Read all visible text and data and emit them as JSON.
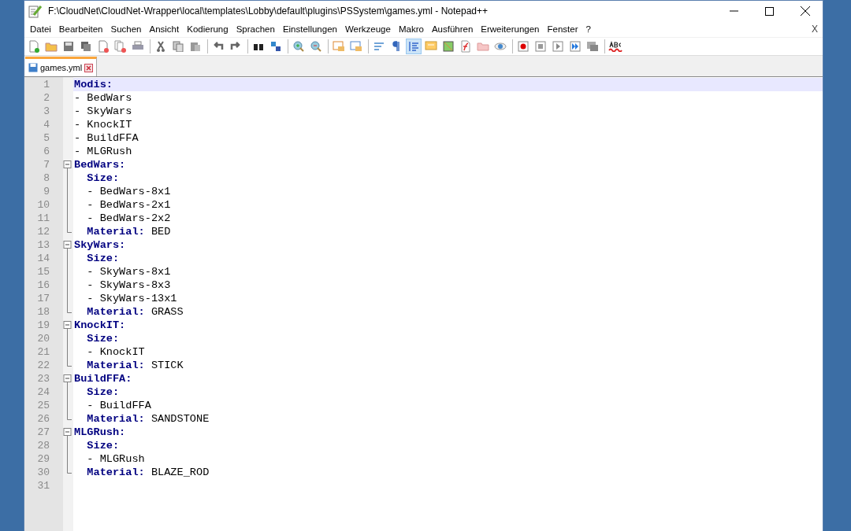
{
  "window": {
    "title": "F:\\CloudNet\\CloudNet-Wrapper\\local\\templates\\Lobby\\default\\plugins\\PSSystem\\games.yml - Notepad++"
  },
  "menu": [
    "Datei",
    "Bearbeiten",
    "Suchen",
    "Ansicht",
    "Kodierung",
    "Sprachen",
    "Einstellungen",
    "Werkzeuge",
    "Makro",
    "Ausführen",
    "Erweiterungen",
    "Fenster",
    "?"
  ],
  "menu_close": "X",
  "toolbar": [
    {
      "pressed": false
    },
    {
      "pressed": false
    },
    {
      "pressed": false
    },
    {
      "pressed": false
    },
    {
      "pressed": false
    },
    {
      "pressed": false
    },
    {
      "pressed": false
    },
    {
      "pressed": false
    },
    {
      "pressed": false
    },
    {
      "pressed": false
    },
    {
      "pressed": false
    },
    {
      "pressed": false
    },
    {
      "pressed": false
    },
    {
      "pressed": false
    },
    {
      "pressed": false
    },
    {
      "pressed": false
    },
    {
      "pressed": false
    },
    {
      "pressed": false
    },
    {
      "pressed": false
    },
    {
      "pressed": false
    },
    {
      "pressed": true
    },
    {
      "pressed": false
    },
    {
      "pressed": false
    },
    {
      "pressed": false
    },
    {
      "pressed": false
    },
    {
      "pressed": false
    },
    {
      "pressed": false
    },
    {
      "pressed": false
    },
    {
      "pressed": false
    },
    {
      "pressed": false
    },
    {
      "pressed": false
    },
    {
      "pressed": false
    }
  ],
  "tabs": [
    {
      "label": "games.yml",
      "selected": true
    }
  ],
  "lines": [
    {
      "number": "1",
      "kind": "plain",
      "key": "Modis:",
      "current": true
    },
    {
      "number": "2",
      "kind": "plain",
      "value": "- BedWars",
      "current": false
    },
    {
      "number": "3",
      "kind": "plain",
      "value": "- SkyWars",
      "current": false
    },
    {
      "number": "4",
      "kind": "plain",
      "value": "- KnockIT",
      "current": false
    },
    {
      "number": "5",
      "kind": "plain",
      "value": "- BuildFFA",
      "current": false
    },
    {
      "number": "6",
      "kind": "plain",
      "value": "- MLGRush",
      "current": false
    },
    {
      "number": "7",
      "kind": "fold-start",
      "key": "BedWars:",
      "current": false
    },
    {
      "number": "8",
      "kind": "fold-line",
      "key": "  Size:",
      "current": false
    },
    {
      "number": "9",
      "kind": "fold-line",
      "value": "  - BedWars-8x1",
      "current": false
    },
    {
      "number": "10",
      "kind": "fold-line",
      "value": "  - BedWars-2x1",
      "current": false
    },
    {
      "number": "11",
      "kind": "fold-line",
      "value": "  - BedWars-2x2",
      "current": false
    },
    {
      "number": "12",
      "kind": "fold-end",
      "key": "  Material:",
      "value": "BED",
      "current": false
    },
    {
      "number": "13",
      "kind": "fold-start",
      "key": "SkyWars:",
      "current": false
    },
    {
      "number": "14",
      "kind": "fold-line",
      "key": "  Size:",
      "current": false
    },
    {
      "number": "15",
      "kind": "fold-line",
      "value": "  - SkyWars-8x1",
      "current": false
    },
    {
      "number": "16",
      "kind": "fold-line",
      "value": "  - SkyWars-8x3",
      "current": false
    },
    {
      "number": "17",
      "kind": "fold-line",
      "value": "  - SkyWars-13x1",
      "current": false
    },
    {
      "number": "18",
      "kind": "fold-end",
      "key": "  Material:",
      "value": "GRASS",
      "current": false
    },
    {
      "number": "19",
      "kind": "fold-start",
      "key": "KnockIT:",
      "current": false
    },
    {
      "number": "20",
      "kind": "fold-line",
      "key": "  Size:",
      "current": false
    },
    {
      "number": "21",
      "kind": "fold-line",
      "value": "  - KnockIT",
      "current": false
    },
    {
      "number": "22",
      "kind": "fold-end",
      "key": "  Material:",
      "value": "STICK",
      "current": false
    },
    {
      "number": "23",
      "kind": "fold-start",
      "key": "BuildFFA:",
      "current": false
    },
    {
      "number": "24",
      "kind": "fold-line",
      "key": "  Size:",
      "current": false
    },
    {
      "number": "25",
      "kind": "fold-line",
      "value": "  - BuildFFA",
      "current": false
    },
    {
      "number": "26",
      "kind": "fold-end",
      "key": "  Material:",
      "value": "SANDSTONE",
      "current": false
    },
    {
      "number": "27",
      "kind": "fold-start",
      "key": "MLGRush:",
      "current": false
    },
    {
      "number": "28",
      "kind": "fold-line",
      "key": "  Size:",
      "current": false
    },
    {
      "number": "29",
      "kind": "fold-line",
      "value": "  - MLGRush",
      "current": false
    },
    {
      "number": "30",
      "kind": "fold-end",
      "key": "  Material:",
      "value": "BLAZE_ROD",
      "current": false
    },
    {
      "number": "31",
      "kind": "plain",
      "current": false
    }
  ]
}
